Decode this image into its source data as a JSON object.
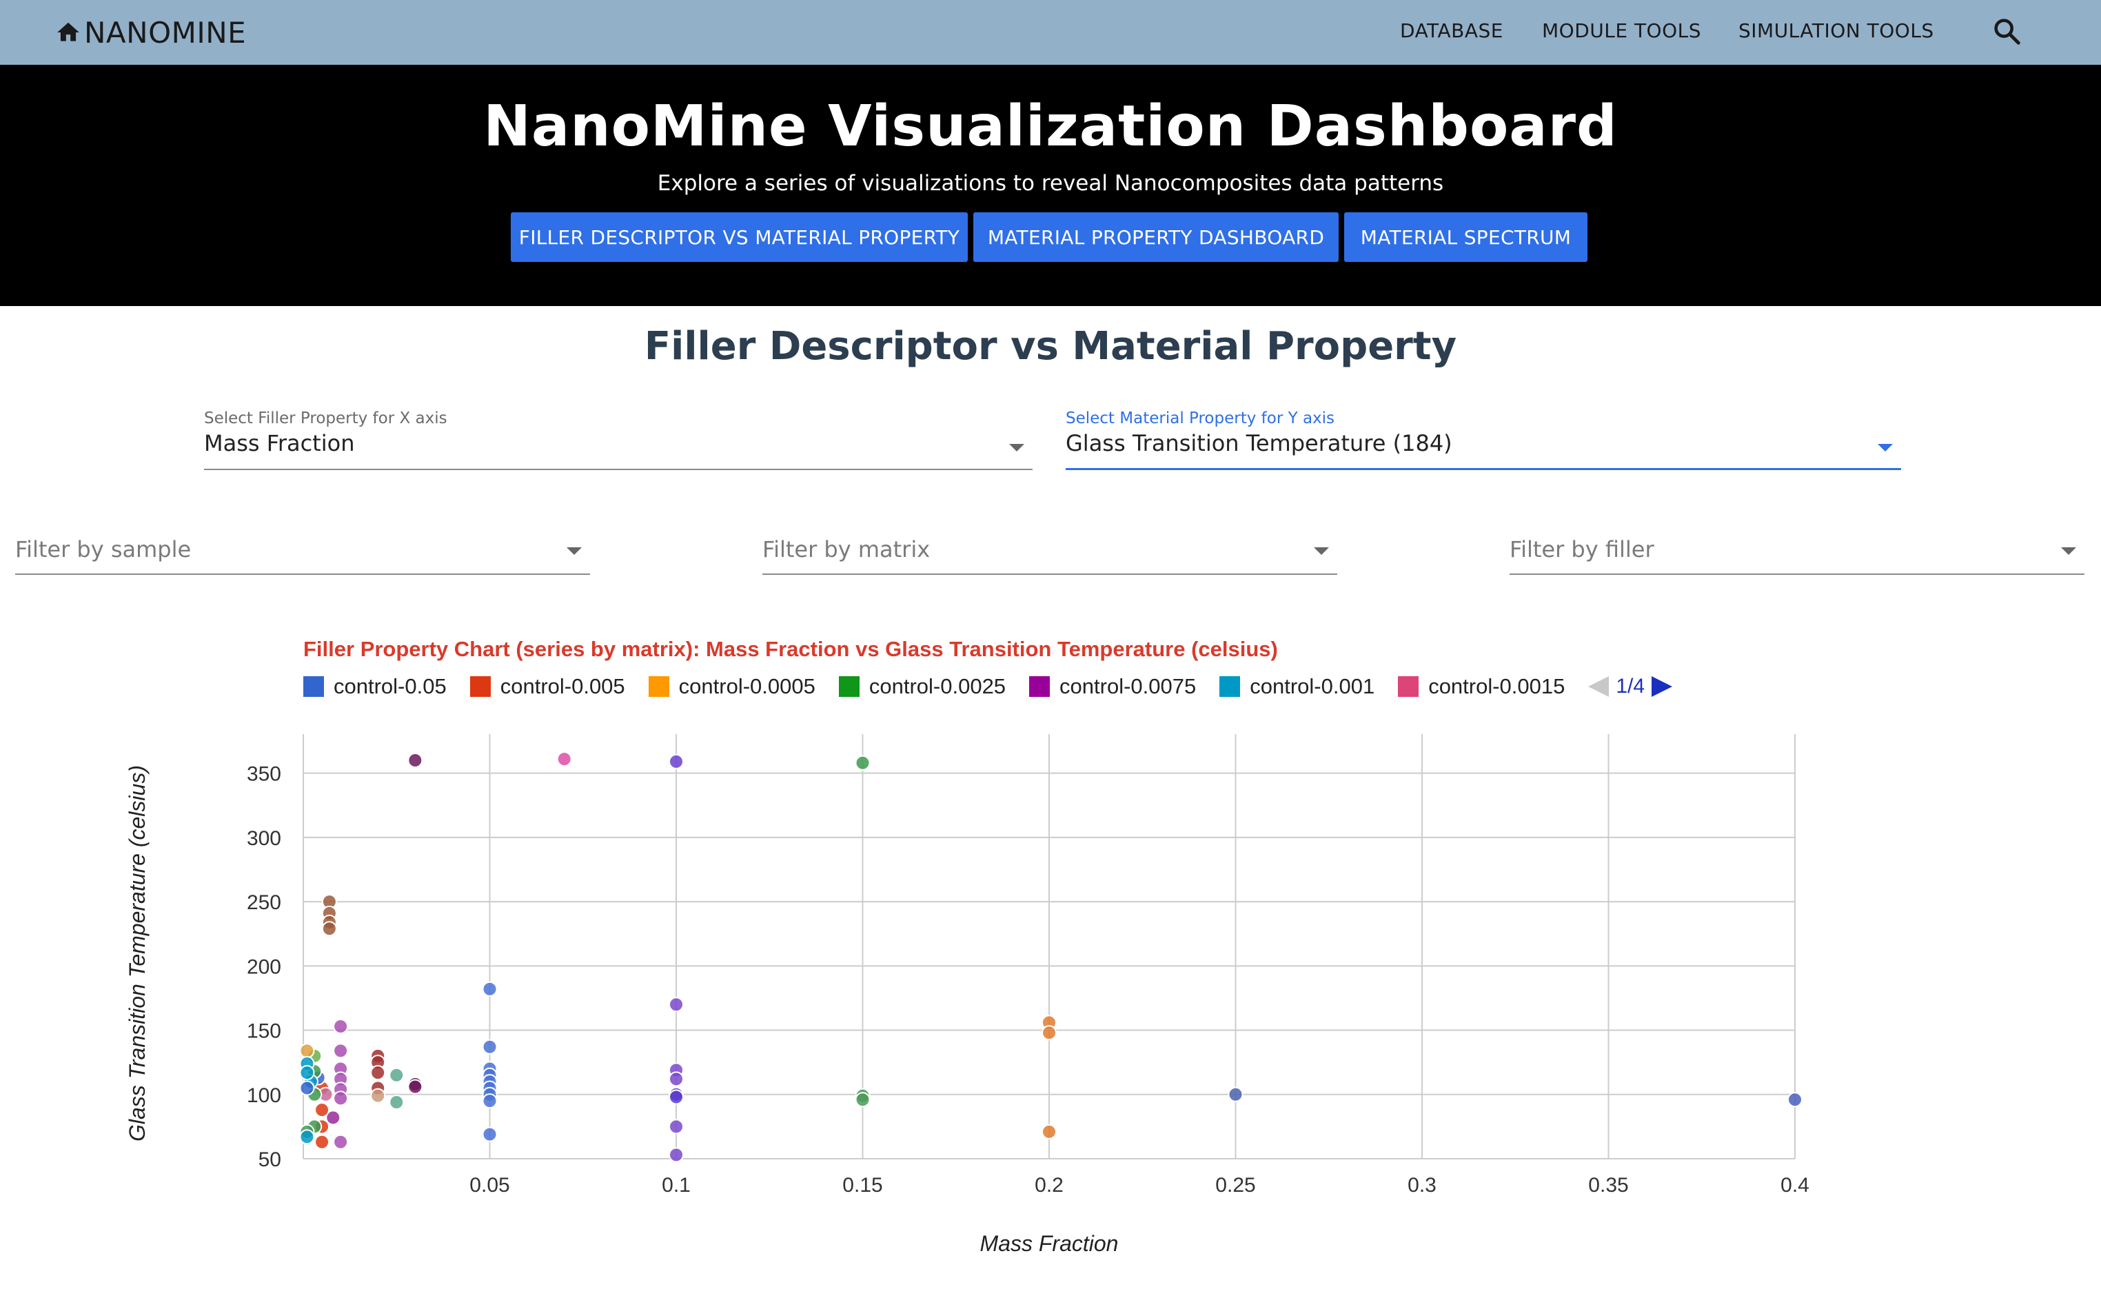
{
  "navbar": {
    "brand": "NANOMINE",
    "items": [
      "DATABASE",
      "MODULE TOOLS",
      "SIMULATION TOOLS"
    ],
    "icons": {
      "home": "home-icon",
      "search": "search-icon"
    }
  },
  "hero": {
    "title": "NanoMine Visualization Dashboard",
    "subtitle": "Explore a series of visualizations to reveal Nanocomposites data patterns",
    "buttons": [
      "FILLER DESCRIPTOR VS MATERIAL PROPERTY",
      "MATERIAL PROPERTY DASHBOARD",
      "MATERIAL SPECTRUM"
    ]
  },
  "section": {
    "title": "Filler Descriptor vs Material Property"
  },
  "x_select": {
    "label": "Select Filler Property for X axis",
    "value": "Mass Fraction"
  },
  "y_select": {
    "label": "Select Material Property for Y axis",
    "value": "Glass Transition Temperature (184)"
  },
  "filters": {
    "sample": {
      "placeholder": "Filter by sample"
    },
    "matrix": {
      "placeholder": "Filter by matrix"
    },
    "filler": {
      "placeholder": "Filter by filler"
    }
  },
  "colors": {
    "accent": "#2f6fe8",
    "navbar": "#93b0c9",
    "chart_title": "#d93a2b"
  },
  "chart_data": {
    "type": "scatter",
    "title": "Filler Property Chart (series by matrix): Mass Fraction vs Glass Transition Temperature (celsius)",
    "xlabel": "Mass Fraction",
    "ylabel": "Glass Transition Temperature (celsius)",
    "xlim": [
      0,
      0.4
    ],
    "ylim": [
      50,
      370
    ],
    "x_ticks": [
      "0.05",
      "0.1",
      "0.15",
      "0.2",
      "0.25",
      "0.3",
      "0.35",
      "0.4"
    ],
    "y_ticks": [
      "50",
      "100",
      "150",
      "200",
      "250",
      "300",
      "350"
    ],
    "grid": true,
    "legend_position": "top",
    "legend_page": "1/4",
    "legend": [
      {
        "name": "control-0.05",
        "color": "#3366cc"
      },
      {
        "name": "control-0.005",
        "color": "#dc3912"
      },
      {
        "name": "control-0.0005",
        "color": "#ff9900"
      },
      {
        "name": "control-0.0025",
        "color": "#109618"
      },
      {
        "name": "control-0.0075",
        "color": "#990099"
      },
      {
        "name": "control-0.001",
        "color": "#0099c6"
      },
      {
        "name": "control-0.0015",
        "color": "#dd4477"
      }
    ],
    "points": [
      {
        "x": 0.03,
        "y": 360,
        "color": "#6b1a5c"
      },
      {
        "x": 0.07,
        "y": 361,
        "color": "#dd4ea8"
      },
      {
        "x": 0.1,
        "y": 359,
        "color": "#6a3fd0"
      },
      {
        "x": 0.15,
        "y": 358,
        "color": "#3d9a4e"
      },
      {
        "x": 0.007,
        "y": 250,
        "color": "#9b5a3a"
      },
      {
        "x": 0.007,
        "y": 241,
        "color": "#9b5a3a"
      },
      {
        "x": 0.007,
        "y": 234,
        "color": "#9b5a3a"
      },
      {
        "x": 0.007,
        "y": 229,
        "color": "#9b5a3a"
      },
      {
        "x": 0.05,
        "y": 182,
        "color": "#4a72d4"
      },
      {
        "x": 0.1,
        "y": 170,
        "color": "#7a48cc"
      },
      {
        "x": 0.2,
        "y": 156,
        "color": "#e07b2e"
      },
      {
        "x": 0.2,
        "y": 148,
        "color": "#e07b2e"
      },
      {
        "x": 0.01,
        "y": 153,
        "color": "#a84fb0"
      },
      {
        "x": 0.05,
        "y": 137,
        "color": "#4a72d4"
      },
      {
        "x": 0.05,
        "y": 120,
        "color": "#4a72d4"
      },
      {
        "x": 0.05,
        "y": 115,
        "color": "#4a72d4"
      },
      {
        "x": 0.05,
        "y": 110,
        "color": "#4a72d4"
      },
      {
        "x": 0.05,
        "y": 105,
        "color": "#4a72d4"
      },
      {
        "x": 0.05,
        "y": 100,
        "color": "#4a72d4"
      },
      {
        "x": 0.05,
        "y": 95,
        "color": "#4a72d4"
      },
      {
        "x": 0.05,
        "y": 69,
        "color": "#4a72d4"
      },
      {
        "x": 0.1,
        "y": 119,
        "color": "#7a48cc"
      },
      {
        "x": 0.1,
        "y": 112,
        "color": "#7a48cc"
      },
      {
        "x": 0.1,
        "y": 100,
        "color": "#5a3ad0"
      },
      {
        "x": 0.1,
        "y": 98,
        "color": "#5a3ad0"
      },
      {
        "x": 0.1,
        "y": 75,
        "color": "#7a48cc"
      },
      {
        "x": 0.1,
        "y": 53,
        "color": "#7a48cc"
      },
      {
        "x": 0.15,
        "y": 99,
        "color": "#4a9a5a"
      },
      {
        "x": 0.15,
        "y": 96,
        "color": "#4a9a5a"
      },
      {
        "x": 0.2,
        "y": 71,
        "color": "#e07b2e"
      },
      {
        "x": 0.25,
        "y": 100,
        "color": "#4a62b0"
      },
      {
        "x": 0.4,
        "y": 96,
        "color": "#4a5fc0"
      },
      {
        "x": 0.02,
        "y": 130,
        "color": "#a0302f"
      },
      {
        "x": 0.02,
        "y": 125,
        "color": "#a0302f"
      },
      {
        "x": 0.02,
        "y": 117,
        "color": "#a0302f"
      },
      {
        "x": 0.02,
        "y": 105,
        "color": "#a0302f"
      },
      {
        "x": 0.02,
        "y": 99,
        "color": "#c89a7a"
      },
      {
        "x": 0.025,
        "y": 115,
        "color": "#5aa890"
      },
      {
        "x": 0.025,
        "y": 94,
        "color": "#5aa890"
      },
      {
        "x": 0.03,
        "y": 108,
        "color": "#6b1a5c"
      },
      {
        "x": 0.03,
        "y": 106,
        "color": "#6b1a5c"
      },
      {
        "x": 0.01,
        "y": 134,
        "color": "#a84fb0"
      },
      {
        "x": 0.01,
        "y": 120,
        "color": "#a84fb0"
      },
      {
        "x": 0.01,
        "y": 112,
        "color": "#a84fb0"
      },
      {
        "x": 0.01,
        "y": 104,
        "color": "#a84fb0"
      },
      {
        "x": 0.01,
        "y": 97,
        "color": "#a84fb0"
      },
      {
        "x": 0.01,
        "y": 63,
        "color": "#a84fb0"
      },
      {
        "x": 0.008,
        "y": 82,
        "color": "#9a2a9a"
      },
      {
        "x": 0.005,
        "y": 105,
        "color": "#dc3912"
      },
      {
        "x": 0.005,
        "y": 88,
        "color": "#dc3912"
      },
      {
        "x": 0.005,
        "y": 75,
        "color": "#dc3912"
      },
      {
        "x": 0.005,
        "y": 63,
        "color": "#dc3912"
      },
      {
        "x": 0.006,
        "y": 100,
        "color": "#c86a9a"
      },
      {
        "x": 0.004,
        "y": 113,
        "color": "#3366cc"
      },
      {
        "x": 0.003,
        "y": 130,
        "color": "#6ab04a"
      },
      {
        "x": 0.003,
        "y": 118,
        "color": "#3d9a4e"
      },
      {
        "x": 0.003,
        "y": 100,
        "color": "#3d9a4e"
      },
      {
        "x": 0.003,
        "y": 75,
        "color": "#3d9a4e"
      },
      {
        "x": 0.002,
        "y": 110,
        "color": "#0099c6"
      },
      {
        "x": 0.001,
        "y": 134,
        "color": "#e0a040"
      },
      {
        "x": 0.001,
        "y": 124,
        "color": "#0099c6"
      },
      {
        "x": 0.001,
        "y": 117,
        "color": "#0099c6"
      },
      {
        "x": 0.001,
        "y": 105,
        "color": "#3366cc"
      },
      {
        "x": 0.001,
        "y": 71,
        "color": "#4a9a5a"
      },
      {
        "x": 0.001,
        "y": 67,
        "color": "#0099c6"
      }
    ]
  }
}
